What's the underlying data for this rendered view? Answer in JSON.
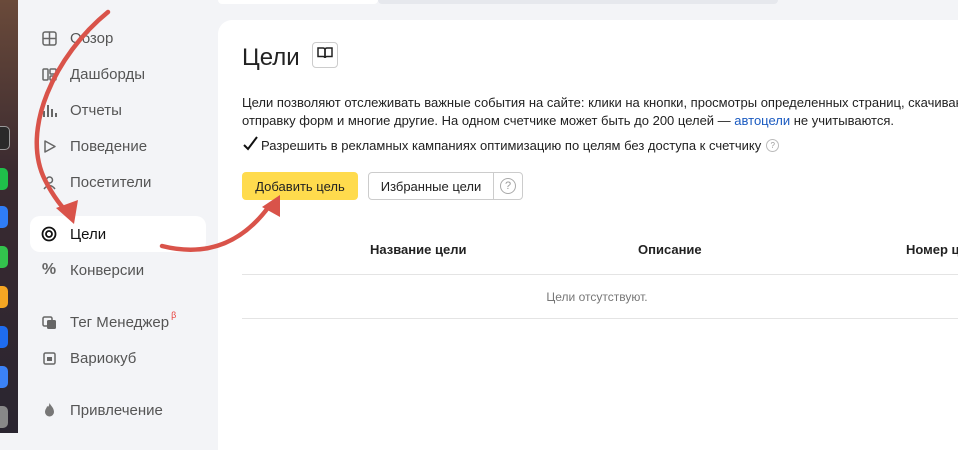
{
  "sidebar": {
    "items": [
      {
        "label": "Обзор",
        "icon": "grid-icon"
      },
      {
        "label": "Дашборды",
        "icon": "dashboard-icon"
      },
      {
        "label": "Отчеты",
        "icon": "bar-chart-icon"
      },
      {
        "label": "Поведение",
        "icon": "play-icon"
      },
      {
        "label": "Посетители",
        "icon": "person-icon"
      },
      {
        "label": "Цели",
        "icon": "target-icon",
        "active": true
      },
      {
        "label": "Конверсии",
        "icon": "percent-icon"
      },
      {
        "label": "Тег Менеджер",
        "icon": "tag-manager-icon",
        "badge": "β"
      },
      {
        "label": "Вариокуб",
        "icon": "variocube-icon"
      },
      {
        "label": "Привлечение",
        "icon": "flame-icon"
      }
    ]
  },
  "main": {
    "title": "Цели",
    "description_line1": "Цели позволяют отслеживать важные события на сайте: клики на кнопки, просмотры определенных страниц, скачиван",
    "description_line2_pre": "отправку форм и многие другие. На одном счетчике может быть до 200 целей — ",
    "description_link": "автоцели",
    "description_line2_post": " не учитываются.",
    "checkbox_label": "Разрешить в рекламных кампаниях оптимизацию по целям без доступа к счетчику",
    "checkbox_checked": true,
    "add_button": "Добавить цель",
    "favorites_button": "Избранные цели",
    "help_symbol": "?",
    "table_headers": [
      "Название цели",
      "Описание",
      "Номер ц"
    ],
    "empty_text": "Цели отсутствуют."
  },
  "colors": {
    "accent_button": "#ffdb4d",
    "link": "#1a5ac0",
    "annotation_arrow": "#d9534a"
  }
}
